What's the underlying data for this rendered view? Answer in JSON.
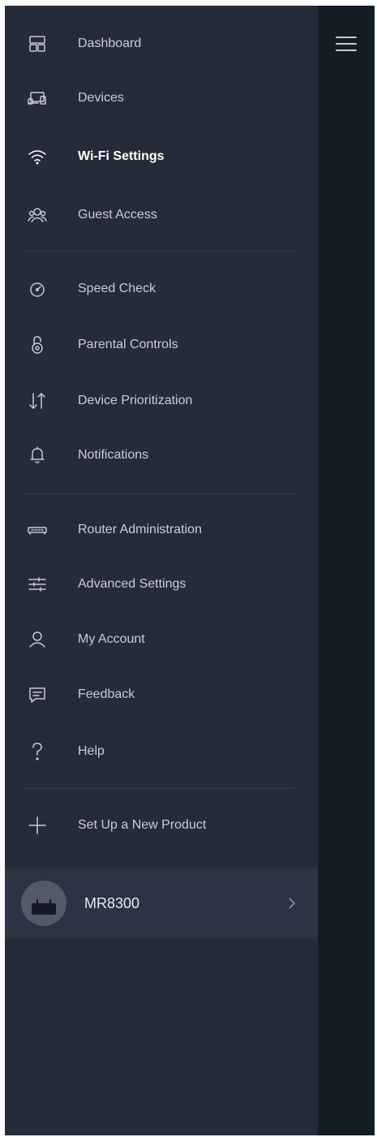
{
  "menu": {
    "items": [
      {
        "label": "Dashboard",
        "icon": "dashboard-icon"
      },
      {
        "label": "Devices",
        "icon": "devices-icon"
      },
      {
        "label": "Wi-Fi Settings",
        "icon": "wifi-icon",
        "active": true
      },
      {
        "label": "Guest Access",
        "icon": "guest-access-icon"
      },
      {
        "label": "Speed Check",
        "icon": "speedometer-icon"
      },
      {
        "label": "Parental Controls",
        "icon": "padlock-icon"
      },
      {
        "label": "Device Prioritization",
        "icon": "prioritization-arrows-icon"
      },
      {
        "label": "Notifications",
        "icon": "bell-icon"
      },
      {
        "label": "Router Administration",
        "icon": "router-icon"
      },
      {
        "label": "Advanced Settings",
        "icon": "sliders-icon"
      },
      {
        "label": "My Account",
        "icon": "user-icon"
      },
      {
        "label": "Feedback",
        "icon": "chat-bubble-icon"
      },
      {
        "label": "Help",
        "icon": "question-icon"
      },
      {
        "label": "Set Up a New Product",
        "icon": "plus-icon"
      }
    ]
  },
  "device": {
    "name": "MR8300",
    "icon": "router-avatar-icon"
  },
  "header": {
    "menu_icon": "hamburger-menu-icon"
  },
  "colors": {
    "drawer_bg": "#252b38",
    "strip_bg": "#141c26",
    "text": "#c9cdd5",
    "active_text": "#ffffff",
    "divider": "#323a48",
    "device_row_bg": "#2c3342"
  }
}
